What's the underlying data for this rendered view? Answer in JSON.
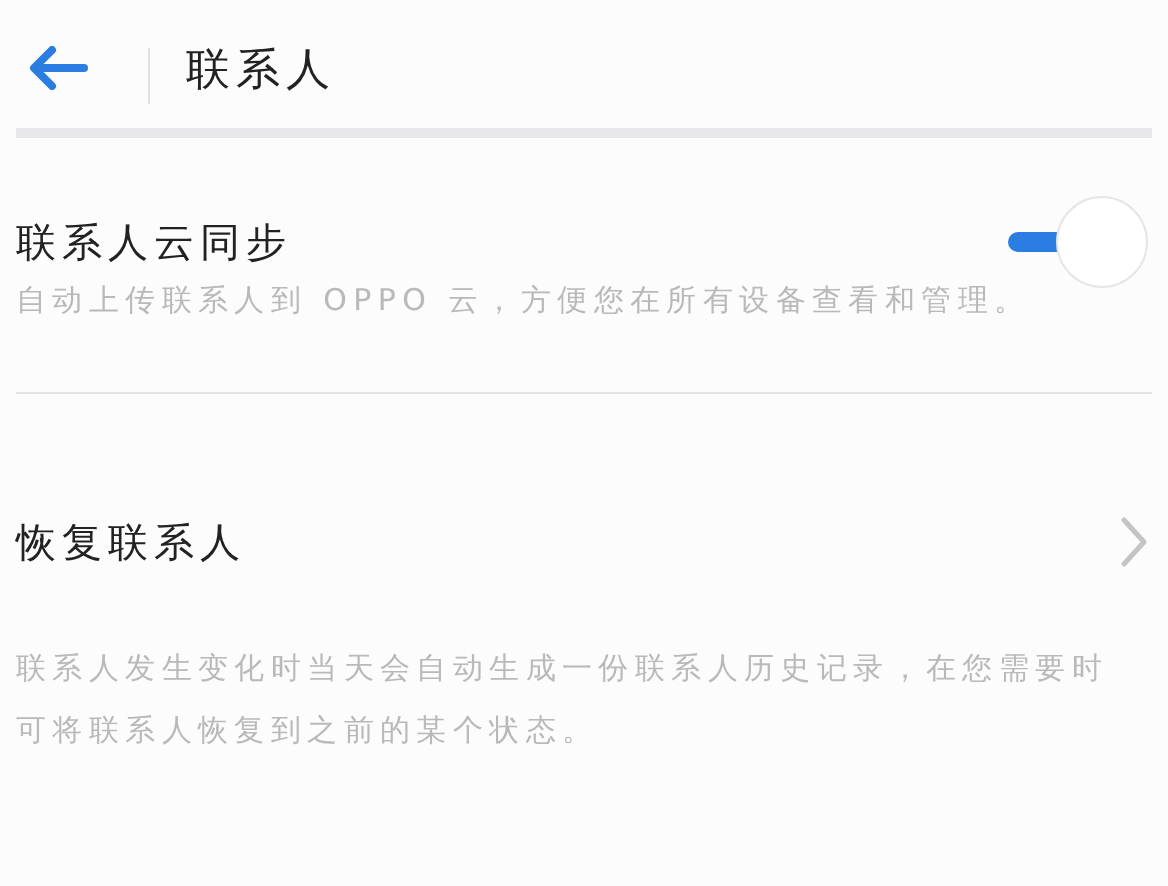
{
  "header": {
    "title": "联系人"
  },
  "settings": [
    {
      "kind": "toggle",
      "label": "联系人云同步",
      "on": true,
      "description": "自动上传联系人到 OPPO 云，方便您在所有设备查看和管理。"
    },
    {
      "kind": "link",
      "label": "恢复联系人",
      "description": "联系人发生变化时当天会自动生成一份联系人历史记录，在您需要时可将联系人恢复到之前的某个状态。"
    }
  ]
}
